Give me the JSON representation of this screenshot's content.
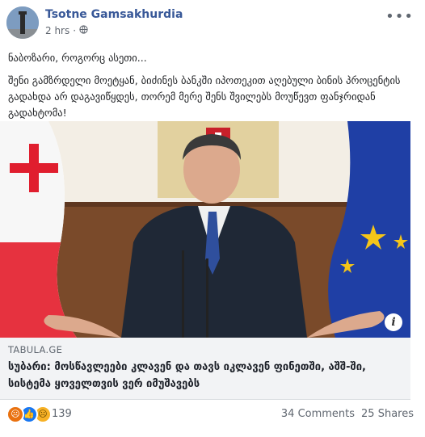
{
  "post": {
    "author": "Tsotne Gamsakhurdia",
    "time": "2 hrs",
    "privacy_icon": "globe-icon",
    "menu_icon": "more-options-icon",
    "text_line1": "ნაბოზარი, როგორც ასეთი...",
    "text_line2": "შენი გამზრდელი მოეტყან, ბიძინეს ბანკში იპოთეკით აღებული ბინის პროცენტის გადახდა არ დაგავიწყდეს, თორემ მერე შენს შვილებს მოუწევთ ფანჯრიდან გადახტომა!"
  },
  "link": {
    "domain": "TABULA.GE",
    "title": "სუბარი: მოსწავლეები კლავენ და თავს იკლავენ ფინეთში, აშშ-ში, სისტემა ყოველთვის ვერ იმუშავებს",
    "info_icon": "i"
  },
  "stats": {
    "reactions_count": "139",
    "comments": "34 Comments",
    "shares": "25 Shares"
  },
  "colors": {
    "author": "#385898",
    "link_bg": "#f2f3f5",
    "angry": "#e9710f",
    "like": "#1877f2",
    "sad": "#f7b125"
  }
}
